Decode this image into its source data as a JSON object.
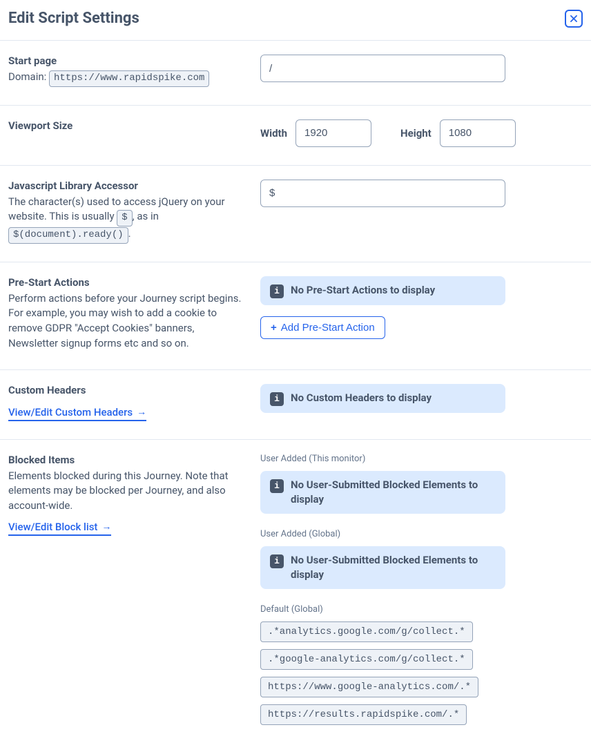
{
  "header": {
    "title": "Edit Script Settings"
  },
  "startPage": {
    "label": "Start page",
    "domain_label": "Domain: ",
    "domain_value": "https://www.rapidspike.com",
    "path_value": "/"
  },
  "viewport": {
    "label": "Viewport Size",
    "width_label": "Width",
    "width_value": "1920",
    "height_label": "Height",
    "height_value": "1080"
  },
  "jsLibrary": {
    "label": "Javascript Library Accessor",
    "desc_pre": "The character(s) used to access jQuery on your website. This is usually ",
    "desc_code1": "$",
    "desc_mid": ", as in ",
    "desc_code2": "$(document).ready()",
    "desc_post": ".",
    "value": "$"
  },
  "preStart": {
    "label": "Pre-Start Actions",
    "desc": "Perform actions before your Journey script begins. For example, you may wish to add a cookie to remove GDPR \"Accept Cookies\" banners, Newsletter signup forms etc and so on.",
    "banner": "No Pre-Start Actions to display",
    "add_label": "Add Pre-Start Action"
  },
  "customHeaders": {
    "label": "Custom Headers",
    "link_label": "View/Edit Custom Headers",
    "banner": "No Custom Headers to display"
  },
  "blocked": {
    "label": "Blocked Items",
    "desc": "Elements blocked during this Journey. Note that elements may be blocked per Journey, and also account-wide.",
    "link_label": "View/Edit Block list",
    "groups": {
      "userMonitor": {
        "heading": "User Added (This monitor)",
        "banner": "No User-Submitted Blocked Elements to display"
      },
      "userGlobal": {
        "heading": "User Added (Global)",
        "banner": "No User-Submitted Blocked Elements to display"
      },
      "defaultGlobal": {
        "heading": "Default (Global)",
        "items": [
          ".*analytics.google.com/g/collect.*",
          ".*google-analytics.com/g/collect.*",
          "https://www.google-analytics.com/.*",
          "https://results.rapidspike.com/.*"
        ]
      }
    }
  }
}
